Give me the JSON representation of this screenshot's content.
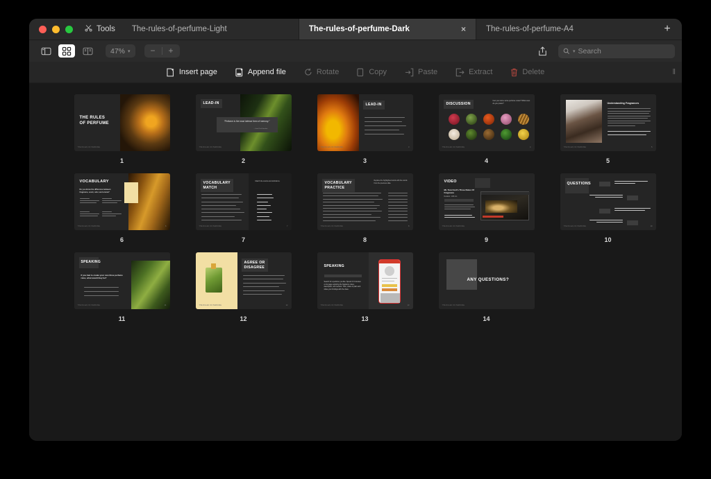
{
  "window": {
    "traffic_lights": [
      "close",
      "minimize",
      "zoom"
    ],
    "tools_label": "Tools",
    "tools_icon": "scissors-icon"
  },
  "tabs": [
    {
      "label": "The-rules-of-perfume-Light",
      "active": false,
      "closable": false
    },
    {
      "label": "The-rules-of-perfume-Dark",
      "active": true,
      "closable": true,
      "close_glyph": "×"
    },
    {
      "label": "The-rules-of-perfume-A4",
      "active": false,
      "closable": false
    }
  ],
  "new_tab_glyph": "+",
  "toolbar": {
    "sidebar_icon": "sidebar-toggle-icon",
    "grid_icon": "grid-view-icon",
    "spread_icon": "page-spread-icon",
    "zoom_value": "47%",
    "zoom_chevron": "▾",
    "zoom_out": "−",
    "zoom_in": "+",
    "share_icon": "share-icon",
    "search_icon": "search-icon",
    "search_chevron": "▾",
    "search_placeholder": "Search",
    "search_value": ""
  },
  "actions": [
    {
      "label": "Insert page",
      "icon": "insert-page-icon",
      "enabled": true
    },
    {
      "label": "Append file",
      "icon": "append-file-icon",
      "enabled": true
    },
    {
      "label": "Rotate",
      "icon": "rotate-icon",
      "enabled": false
    },
    {
      "label": "Copy",
      "icon": "copy-icon",
      "enabled": false
    },
    {
      "label": "Paste",
      "icon": "paste-icon",
      "enabled": false
    },
    {
      "label": "Extract",
      "icon": "extract-icon",
      "enabled": false
    },
    {
      "label": "Delete",
      "icon": "trash-icon",
      "enabled": false
    }
  ],
  "grip_glyph": "‖",
  "pages": [
    {
      "number": "1",
      "kind": "title",
      "title": "THE RULES\nOF PERFUME",
      "photo": "amber"
    },
    {
      "number": "2",
      "kind": "quote",
      "title": "LEAD-IN",
      "quote": "“Perfume is the most intense form of memory.”",
      "attribution": "—Jean Paul Guerlain",
      "photo": "leafdark"
    },
    {
      "number": "3",
      "kind": "photo-left-bullets",
      "title": "LEAD-IN",
      "bullets": 5,
      "photo": "petal"
    },
    {
      "number": "4",
      "kind": "discussion",
      "title": "DISCUSSION",
      "prompt": "Can you name some perfume notes? What ones do you prefer?",
      "swatch_count": 10
    },
    {
      "number": "5",
      "kind": "reading",
      "title": "Understanding Fragrances",
      "photo": "wood",
      "paragraphs": 8,
      "bullets": 2
    },
    {
      "number": "6",
      "kind": "vocabulary",
      "title": "VOCABULARY",
      "prompt": "Do you know the difference between fragrance, scent, odor, and aroma?",
      "cards": 4,
      "photo": "shelf"
    },
    {
      "number": "7",
      "kind": "match",
      "title": "VOCABULARY\nMATCH",
      "prompt": "Match the words and definitions.",
      "items": 8,
      "words": 8
    },
    {
      "number": "8",
      "kind": "practice",
      "title": "VOCABULARY\nPRACTICE",
      "prompt": "Replace the highlighted words with the words from the previous slide.",
      "items": 10,
      "blanks": 10
    },
    {
      "number": "9",
      "kind": "video",
      "title": "VIDEO",
      "video_title": "Mr. Tom Ford’s Three Rules Of Fragrance",
      "duration": "Duration: 1:08 min",
      "photo": "video"
    },
    {
      "number": "10",
      "kind": "questions",
      "title": "QUESTIONS",
      "items": 4
    },
    {
      "number": "11",
      "kind": "speaking",
      "title": "SPEAKING",
      "prompt": "If you had to create your own three perfume rules, what would they be?",
      "blanks": 3,
      "photo": "greenleaf"
    },
    {
      "number": "12",
      "kind": "agree",
      "title": "AGREE OR\nDISAGREE",
      "items": 6,
      "photo": "cream"
    },
    {
      "number": "13",
      "kind": "speaking-phone",
      "title": "SPEAKING",
      "prompt": "Search for a perfume you like. Spend 3–5 minutes on its page exploring the fragrance notes, description, and reviews. Then, share in pairs and share your findings with the class.",
      "photo": "phone"
    },
    {
      "number": "14",
      "kind": "closing",
      "title": "ANY QUESTIONS?",
      "photo": "gray"
    }
  ],
  "footer_text": "THE RULES OF PERFUME",
  "colors": {
    "window_bg": "#1b1b1b",
    "tabbar_bg": "#2a2a2a",
    "active_tab_bg": "#3a3a3a",
    "canvas_bg": "#191919",
    "slide_bg": "#252525",
    "accent_yellow": "#f2dfa4",
    "delete_red": "#b4473f"
  }
}
